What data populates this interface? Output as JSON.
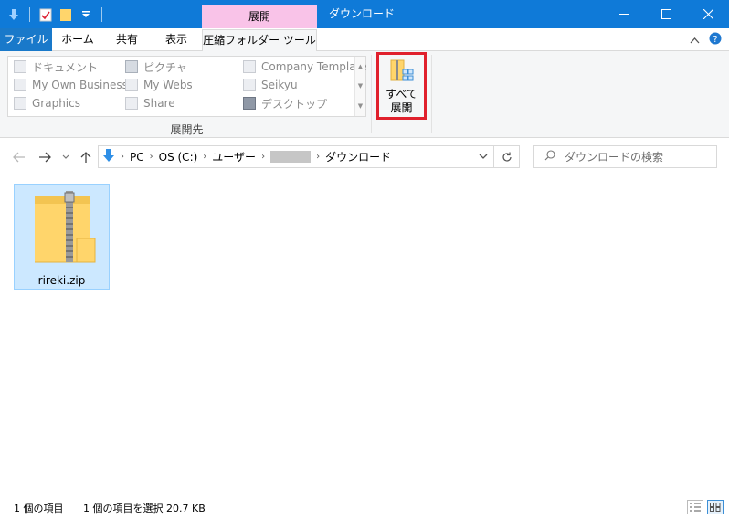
{
  "title_bar": {
    "context_tab_header": "展開",
    "window_title": "ダウンロード"
  },
  "ribbon_tabs": {
    "file": "ファイル",
    "home": "ホーム",
    "share": "共有",
    "view": "表示",
    "compressed_folder_tools": "圧縮フォルダー ツール"
  },
  "ribbon": {
    "destinations": [
      {
        "label": "ドキュメント",
        "icon": "document-folder-icon"
      },
      {
        "label": "ピクチャ",
        "icon": "pictures-folder-icon"
      },
      {
        "label": "Company Template",
        "icon": "folder-icon"
      },
      {
        "label": "My Own Business",
        "icon": "folder-icon"
      },
      {
        "label": "My Webs",
        "icon": "folder-icon"
      },
      {
        "label": "Seikyu",
        "icon": "folder-icon"
      },
      {
        "label": "Graphics",
        "icon": "folder-icon"
      },
      {
        "label": "Share",
        "icon": "folder-icon"
      },
      {
        "label": "デスクトップ",
        "icon": "desktop-icon"
      }
    ],
    "group_label": "展開先",
    "extract_all_line1": "すべて",
    "extract_all_line2": "展開"
  },
  "address_bar": {
    "crumbs": [
      "PC",
      "OS (C:)",
      "ユーザー",
      "ダウンロード"
    ],
    "search_placeholder": "ダウンロードの検索"
  },
  "files": [
    {
      "name": "rireki.zip",
      "icon": "zip-folder-icon",
      "selected": true
    }
  ],
  "status_bar": {
    "item_count": "1 個の項目",
    "selection": "1 個の項目を選択  20.7 KB"
  },
  "colors": {
    "titlebar": "#0f7ad8",
    "context_tab": "#f9c3e8",
    "file_tab": "#1979ca",
    "highlight_box": "#e0202c",
    "selection_fill": "#cce8ff"
  }
}
